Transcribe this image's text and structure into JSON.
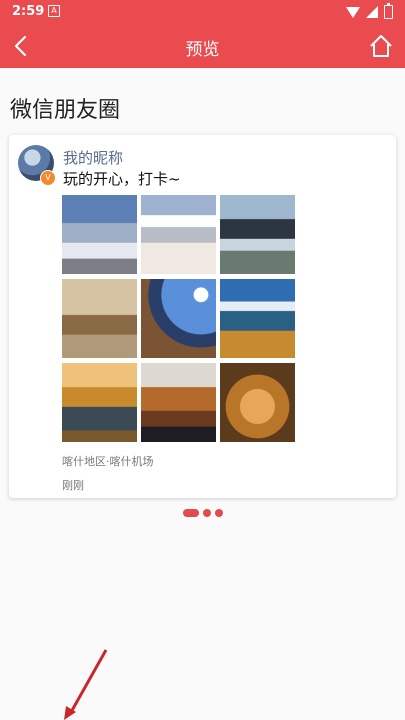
{
  "status_bar": {
    "time": "2:59",
    "notification_badge": "A"
  },
  "app_bar": {
    "title": "预览",
    "color": "#ea4b4f"
  },
  "section": {
    "title": "微信朋友圈"
  },
  "post": {
    "nickname": "我的昵称",
    "text": "玩的开心，打卡~",
    "avatar_badge": "V",
    "photos": [
      "snow-mountains-blue-sky",
      "snowy-hills",
      "mountain-lake-reflection",
      "old-cart-village",
      "sunburst-village",
      "blue-lake-mountains",
      "autumn-trees-river",
      "grilled-skewers",
      "fried-dish"
    ],
    "location": "喀什地区·喀什机场",
    "time": "刚刚"
  },
  "pager": {
    "pages": 3,
    "current": 1
  },
  "icons": {
    "back": "chevron-left-icon",
    "home": "home-icon"
  }
}
